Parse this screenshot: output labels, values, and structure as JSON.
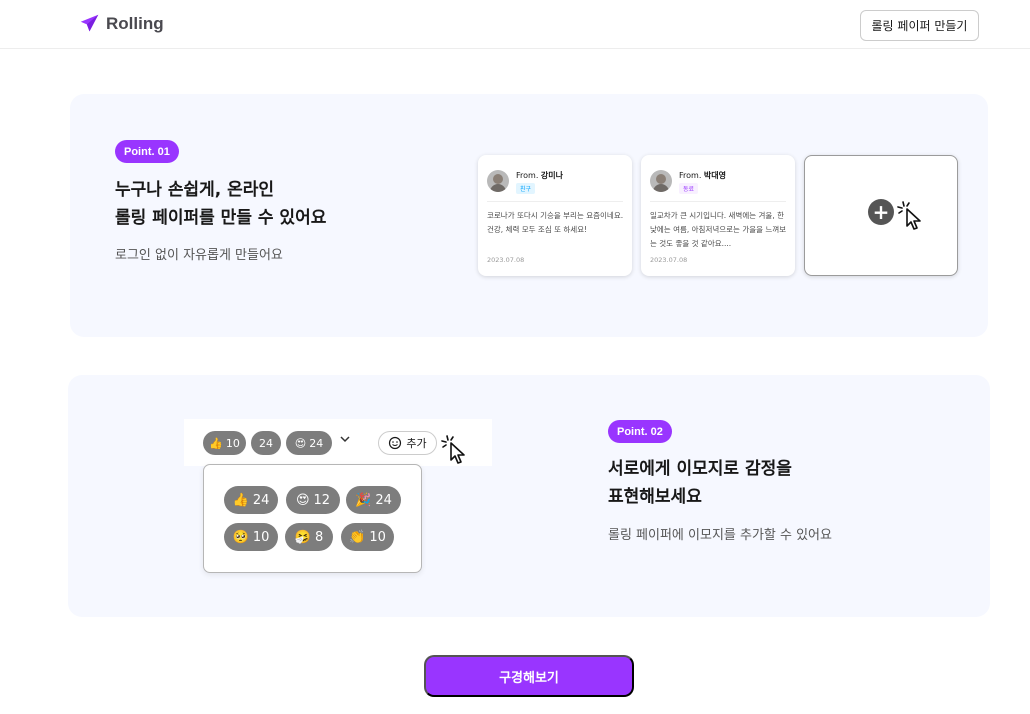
{
  "header": {
    "logo_text": "Rolling",
    "make_button": "롤링 페이퍼 만들기"
  },
  "point1": {
    "badge": "Point. 01",
    "title_line1": "누구나 손쉽게, 온라인",
    "title_line2": "롤링 페이퍼를 만들 수 있어요",
    "subtitle": "로그인 없이 자유롭게 만들어요",
    "messages": [
      {
        "from_prefix": "From.",
        "name": "강미나",
        "relation": "친구",
        "body": "코로나가 또다시 기승을 부리는 요즘이네요. 건강, 체력 모두 조심 또 하세요!",
        "date": "2023.07.08"
      },
      {
        "from_prefix": "From.",
        "name": "박대영",
        "relation": "동료",
        "body": "일교차가 큰 시기입니다. 새벽에는 겨울, 한낮에는 여름, 아침저녁으로는 가을을 느껴보는 것도 좋을 것 같아요....",
        "date": "2023.07.08"
      }
    ],
    "add_icon": "plus-icon"
  },
  "point2": {
    "badge": "Point. 02",
    "title_line1": "서로에게 이모지로 감정을",
    "title_line2": "표현해보세요",
    "subtitle": "롤링 페이퍼에 이모지를 추가할 수 있어요",
    "top_reactions": [
      {
        "emoji": "👍",
        "count": "10"
      },
      {
        "emoji": "",
        "count": "24"
      },
      {
        "emoji": "😍",
        "count": "24"
      }
    ],
    "add_label": "추가",
    "popover_reactions": [
      {
        "emoji": "👍",
        "count": "24"
      },
      {
        "emoji": "😍",
        "count": "12"
      },
      {
        "emoji": "🎉",
        "count": "24"
      },
      {
        "emoji": "🥺",
        "count": "10"
      },
      {
        "emoji": "🤧",
        "count": "8"
      },
      {
        "emoji": "👏",
        "count": "10"
      }
    ]
  },
  "cta": {
    "label": "구경해보기"
  },
  "colors": {
    "accent": "#9935ff",
    "card_bg": "#f6f8ff",
    "pill_bg": "#7d7d7d"
  }
}
